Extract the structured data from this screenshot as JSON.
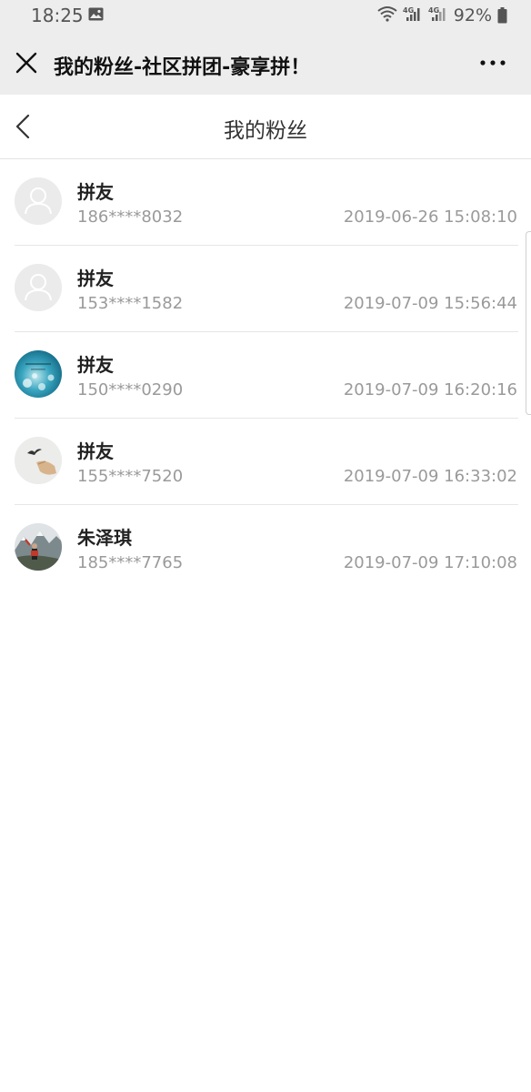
{
  "status_bar": {
    "time": "18:25",
    "battery": "92%",
    "icons": [
      "image-icon",
      "wifi-icon",
      "signal-4g-icon",
      "signal-4g-icon",
      "battery-icon"
    ]
  },
  "wechat_bar": {
    "title": "我的粉丝-社区拼团-豪享拼！",
    "close_icon": "close-icon",
    "more_icon": "more-icon"
  },
  "page": {
    "title": "我的粉丝",
    "back_icon": "back-icon"
  },
  "fans": [
    {
      "name": "拼友",
      "phone": "186****8032",
      "time": "2019-06-26 15:08:10",
      "avatar": "default-avatar"
    },
    {
      "name": "拼友",
      "phone": "153****1582",
      "time": "2019-07-09 15:56:44",
      "avatar": "default-avatar"
    },
    {
      "name": "拼友",
      "phone": "150****0290",
      "time": "2019-07-09 16:20:16",
      "avatar": "photo-avatar-teal"
    },
    {
      "name": "拼友",
      "phone": "155****7520",
      "time": "2019-07-09 16:33:02",
      "avatar": "photo-avatar-bird"
    },
    {
      "name": "朱泽琪",
      "phone": "185****7765",
      "time": "2019-07-09 17:10:08",
      "avatar": "photo-avatar-mountain"
    }
  ],
  "colors": {
    "bar_bg": "#ededed",
    "text_primary": "#222222",
    "text_secondary": "#9a9a9a",
    "divider": "#e6e6e6"
  }
}
